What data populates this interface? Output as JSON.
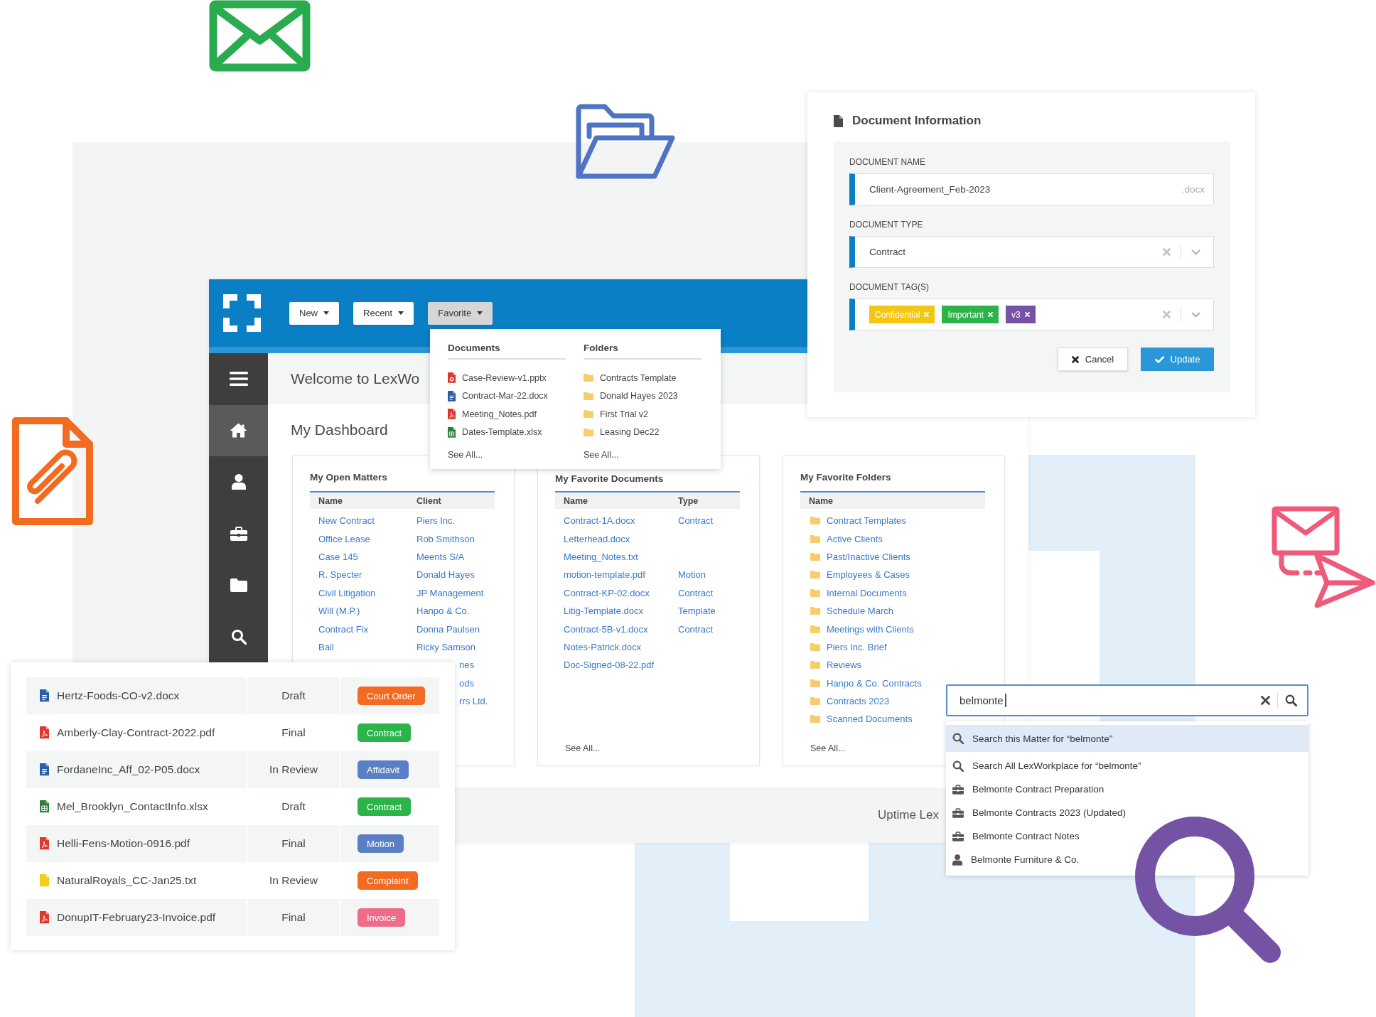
{
  "app": {
    "menu_buttons": [
      {
        "label": "New",
        "selected": false
      },
      {
        "label": "Recent",
        "selected": false
      },
      {
        "label": "Favorite",
        "selected": true
      }
    ],
    "sidebar": [
      {
        "kind": "menu",
        "selected": false
      },
      {
        "kind": "home",
        "selected": true
      },
      {
        "kind": "person",
        "selected": false
      },
      {
        "kind": "briefcase",
        "selected": false
      },
      {
        "kind": "folder",
        "selected": false
      },
      {
        "kind": "search",
        "selected": false
      }
    ],
    "welcome": "Welcome to LexWo",
    "dashboard": {
      "title": "My Dashboard",
      "open_matters": {
        "heading": "My Open Matters",
        "columns": [
          "Name",
          "Client"
        ],
        "rows": [
          {
            "name": "New Contract",
            "client": "Piers Inc."
          },
          {
            "name": "Office Lease",
            "client": "Rob Smithson"
          },
          {
            "name": "Case 145",
            "client": "Meents S/A"
          },
          {
            "name": "R. Specter",
            "client": "Donald Hayes"
          },
          {
            "name": "Civil Litigation",
            "client": "JP Management"
          },
          {
            "name": "Will (M.P.)",
            "client": "Hanpo & Co."
          },
          {
            "name": "Contract Fix",
            "client": "Donna Paulsen"
          },
          {
            "name": "Bail",
            "client": "Ricky Samson"
          },
          {
            "client": "nes"
          },
          {
            "client": "ods"
          },
          {
            "client": "rrs Ltd."
          }
        ]
      },
      "favorite_documents": {
        "heading": "My Favorite Documents",
        "columns": [
          "Name",
          "Type"
        ],
        "rows": [
          {
            "name": "Contract-1A.docx",
            "type": "Contract"
          },
          {
            "name": "Letterhead.docx"
          },
          {
            "name": "Meeting_Notes.txt"
          },
          {
            "name": "motion-template.pdf",
            "type": "Motion"
          },
          {
            "name": "Contract-KP-02.docx",
            "type": "Contract"
          },
          {
            "name": "Litig-Template.docx",
            "type": "Template"
          },
          {
            "name": "Contract-5B-v1.docx",
            "type": "Contract"
          },
          {
            "name": "Notes-Patrick.docx"
          },
          {
            "name": "Doc-Signed-08-22.pdf"
          }
        ],
        "see_all": "See All..."
      },
      "favorite_folders": {
        "heading": "My Favorite Folders",
        "columns": [
          "Name"
        ],
        "items": [
          "Contract Templates",
          "Active Clients",
          "Past/Inactive Clients",
          "Employees & Cases",
          "Internal Documents",
          "Schedule March",
          "Meetings with Clients",
          "Piers Inc. Brief",
          "Reviews",
          "Hanpo & Co. Contracts",
          "Contracts 2023",
          "Scanned Documents"
        ],
        "see_all": "See All..."
      }
    },
    "footer": "Uptime Lex"
  },
  "favorite_menu": {
    "documents": {
      "heading": "Documents",
      "items": [
        {
          "kind": "pptx",
          "name": "Case-Review-v1.pptx"
        },
        {
          "kind": "docx",
          "name": "Contract-Mar-22.docx"
        },
        {
          "kind": "pdf",
          "name": "Meeting_Notes.pdf"
        },
        {
          "kind": "xlsx",
          "name": "Dates-Template.xlsx"
        }
      ],
      "see_all": "See All..."
    },
    "folders": {
      "heading": "Folders",
      "items": [
        "Contracts Template",
        "Donald Hayes 2023",
        "First Trial v2",
        "Leasing Dec22"
      ],
      "see_all": "See All..."
    }
  },
  "document_info": {
    "title": "Document Information",
    "fields": [
      {
        "kind": "text",
        "label": "DOCUMENT NAME",
        "value": "Client-Agreement_Feb-2023",
        "suffix": ".docx"
      },
      {
        "kind": "select",
        "label": "DOCUMENT TYPE",
        "value": "Contract"
      },
      {
        "kind": "tags",
        "label": "DOCUMENT TAG(S)",
        "tags": [
          {
            "label": "Confidential",
            "color": "#f3c614"
          },
          {
            "label": "Important",
            "color": "#2db34a"
          },
          {
            "label": "v3",
            "color": "#7652a5"
          }
        ]
      }
    ],
    "buttons": [
      {
        "kind": "cancel",
        "label": "Cancel"
      },
      {
        "kind": "confirm",
        "label": "Update"
      }
    ]
  },
  "file_list": [
    {
      "kind": "docx",
      "name": "Hertz-Foods-CO-v2.docx",
      "status": "Draft",
      "tag": {
        "label": "Court Order",
        "color": "#f26b21"
      }
    },
    {
      "kind": "pdf",
      "name": "Amberly-Clay-Contract-2022.pdf",
      "status": "Final",
      "tag": {
        "label": "Contract",
        "color": "#2bb44a"
      }
    },
    {
      "kind": "docx",
      "name": "FordaneInc_Aff_02-P05.docx",
      "status": "In Review",
      "tag": {
        "label": "Affidavit",
        "color": "#5b7fc4"
      }
    },
    {
      "kind": "xlsx",
      "name": "Mel_Brooklyn_ContactInfo.xlsx",
      "status": "Draft",
      "tag": {
        "label": "Contract",
        "color": "#2bb44a"
      }
    },
    {
      "kind": "pdf",
      "name": "Helli-Fens-Motion-0916.pdf",
      "status": "Final",
      "tag": {
        "label": "Motion",
        "color": "#5b7fc4"
      }
    },
    {
      "kind": "txt",
      "name": "NaturalRoyals_CC-Jan25.txt",
      "status": "In Review",
      "tag": {
        "label": "Complaint",
        "color": "#f26b21"
      }
    },
    {
      "kind": "pdf",
      "name": "DonupIT-February23-Invoice.pdf",
      "status": "Final",
      "tag": {
        "label": "Invoice",
        "color": "#ef6b8a"
      }
    }
  ],
  "search": {
    "value": "belmonte",
    "results": [
      {
        "kind": "search",
        "text": "Search this Matter for “belmonte”",
        "selected": true
      },
      {
        "kind": "search",
        "text": "Search All LexWorkplace for “belmonte”",
        "selected": false
      },
      {
        "kind": "matter",
        "text": "Belmonte Contract Preparation",
        "selected": false
      },
      {
        "kind": "matter",
        "text": "Belmonte Contracts 2023 (Updated)",
        "selected": false
      },
      {
        "kind": "matter",
        "text": "Belmonte Contract Notes",
        "selected": false
      },
      {
        "kind": "contact",
        "text": "Belmonte Furniture & Co.",
        "selected": false
      }
    ]
  }
}
